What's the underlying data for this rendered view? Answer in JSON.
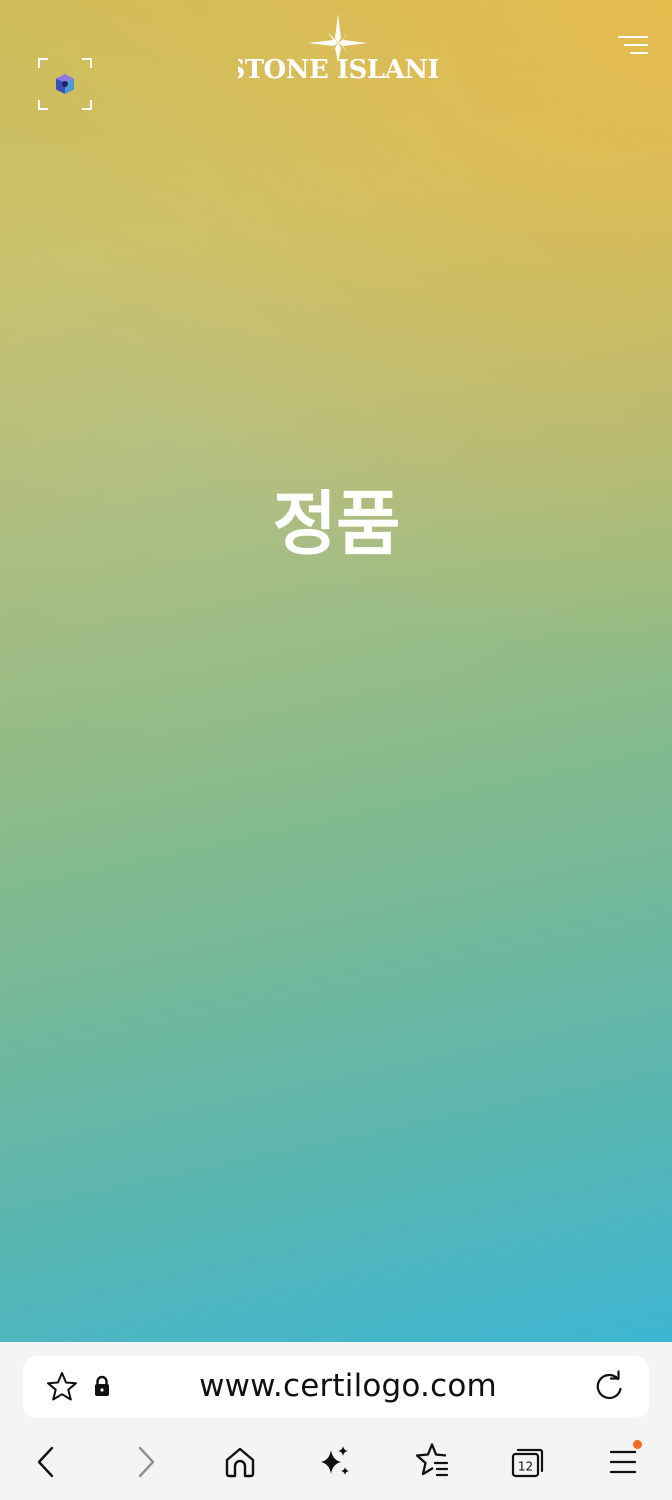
{
  "page": {
    "brand": "STONE ISLAND",
    "hero_text": "정품"
  },
  "browser": {
    "url": "www.certilogo.com",
    "tab_count": "12",
    "menu_has_notification": true
  },
  "icons": {
    "scan": "scan-frame-icon",
    "menu": "hamburger-menu-icon",
    "bookmark": "star-icon",
    "lock": "lock-icon",
    "reload": "reload-icon",
    "back": "chevron-left-icon",
    "forward": "chevron-right-icon",
    "home": "home-icon",
    "assistant": "sparkle-icon",
    "bookmarks": "star-list-icon",
    "tabs": "tabs-icon",
    "browser_menu": "browser-menu-icon"
  },
  "colors": {
    "gradient_top": "#d1bd5a",
    "gradient_bottom": "#3db6d2",
    "accent_corner": "#eeba46",
    "notification": "#f06a21"
  }
}
